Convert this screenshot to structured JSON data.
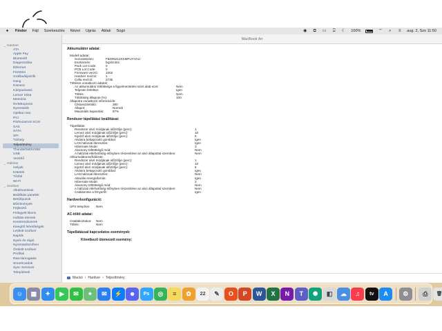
{
  "menubar": {
    "apple": "",
    "items": [
      "Finder",
      "Fájl",
      "Szerkesztés",
      "Nézet",
      "Ugrás",
      "Ablak",
      "Súgó"
    ],
    "battery": "100%",
    "clock": "aug. 2, Szo 11:50"
  },
  "window": {
    "title": "MacBook Air"
  },
  "sidebar": {
    "groups": [
      {
        "label": "Hardver",
        "items": [
          "ATA",
          "Apple Pay",
          "Bluetooth",
          "Diagnosztika",
          "Ethernet",
          "FireWire",
          "Grafika/kijelzők",
          "Hang",
          "Kamera",
          "Kártyaolvasó",
          "Lemez írása",
          "Memória",
          "NVMExpress",
          "Nyomtatók",
          "Optikai csat",
          "PCI",
          "Párhuzamos SCSI",
          "SAS",
          "SATA",
          "SPI",
          "Tárhely",
          "Teljesítmény",
          "Thunderbolt/USB4",
          "USB",
          "Vezérlő"
        ]
      },
      {
        "label": "Hálózat",
        "items": [
          "Helyek",
          "Kötetek",
          "Tűzfal",
          "Wi-Fi"
        ]
      },
      {
        "label": "Szoftver",
        "items": [
          "Alkalmazások",
          "Beállítási panelek",
          "Betűtípusok",
          "Bővítmények",
          "Fejlesztő",
          "Felügyelt kliens",
          "Indítási elemek",
          "Keretrendszerek",
          "Kisegítő lehetőségek",
          "Letiltott szoftver",
          "Naplók",
          "Nyelv és régió",
          "Nyomtatószoftver",
          "Örökölt szoftver",
          "Profilok",
          "Raw-támogatás",
          "SmartCardok",
          "Sync Services",
          "Telepítések"
        ]
      }
    ],
    "selected": "Teljesítmény"
  },
  "content": {
    "battery_heading": "Akkumulátor adatai:",
    "model_heading": "Modell adatai:",
    "model": [
      {
        "k": "Sorozatszám:",
        "v": "F5D05212XXMPUYVAU"
      },
      {
        "k": "Eszköznév:",
        "v": "bq20z451"
      },
      {
        "k": "Pack Lot Code:",
        "v": "0"
      },
      {
        "k": "PCB Lot Code:",
        "v": "0"
      },
      {
        "k": "Firmware verzió:",
        "v": "1002"
      },
      {
        "k": "Hardver revízió:",
        "v": "1"
      },
      {
        "k": "Cella revízió:",
        "v": "2735"
      }
    ],
    "charge_heading": "Töltésre vonatkozó adatok:",
    "charge": [
      {
        "k": "Az akkumulátor töltöttsége a figyelmeztetési szint alatt ecet:",
        "v": "Nem"
      },
      {
        "k": "Teljesen feltöltve:",
        "v": "Igen"
      },
      {
        "k": "Töltés:",
        "v": "Nem"
      },
      {
        "k": "Töltöttség állapota (%):",
        "v": "100"
      }
    ],
    "health_heading": "Állapotra vonatkozó információk:",
    "health": [
      {
        "k": "Ciklusszámláló:",
        "v": "380"
      },
      {
        "k": "Állapot:",
        "v": "Normál"
      },
      {
        "k": "Maximális kapacitás:",
        "v": "87%"
      }
    ],
    "power_heading": "Rendszer tápellátási beállításai:",
    "ac_heading": "Tápellátás:",
    "ac": [
      {
        "k": "Rendszer alvó módjának időzítője (perc):",
        "v": "1"
      },
      {
        "k": "Lemez alvó módjának időzítője (perc):",
        "v": "10"
      },
      {
        "k": "Kijelző alvó módjának időzítője (perc):",
        "v": "5"
      },
      {
        "k": "Alvásra bekapcsoló gombbal:",
        "v": "Igen"
      },
      {
        "k": "LAN hálózati ébresztés:",
        "v": "Igen"
      },
      {
        "k": "Hibernate Mode:",
        "v": "3"
      },
      {
        "k": "Alacsony töltöttségű mód:",
        "v": "Nem"
      },
      {
        "k": "A hálózati elérhetőség előnyben részesítése az alvó állapottal szemben:",
        "v": "Nem"
      }
    ],
    "bat_heading": "Akkumulátoros/hálózati:",
    "bat": [
      {
        "k": "Rendszer alvó módjának időzítője (perc):",
        "v": "1"
      },
      {
        "k": "Lemez alvó módjának időzítője (perc):",
        "v": "10"
      },
      {
        "k": "Kijelző alvó módjának időzítője (perc):",
        "v": "5"
      },
      {
        "k": "Alvásra bekapcsoló gombbal:",
        "v": "Igen"
      },
      {
        "k": "LAN hálózati ébresztés:",
        "v": "Nem"
      },
      {
        "k": "Aktuális energiaforrás:",
        "v": "Igen"
      },
      {
        "k": "Hibernate Mode:",
        "v": "3"
      },
      {
        "k": "Alacsony töltöttségű mód:",
        "v": "Nem"
      },
      {
        "k": "A hálózati elérhetőség előnyben részesítése az alvó állapottal szemben:",
        "v": "Nem"
      },
      {
        "k": "Csökkentse a fényerőt:",
        "v": "Igen"
      }
    ],
    "hw_heading": "Hardverkonfiguráció:",
    "hw": [
      {
        "k": "UPS telepítve:",
        "v": "Nem"
      }
    ],
    "acc_heading": "AC-töltő adatai:",
    "acc": [
      {
        "k": "Csatlakoztatva:",
        "v": "Nem"
      },
      {
        "k": "Töltés:",
        "v": "Nem"
      }
    ],
    "events_heading": "Tápellátással kapcsolatos események:",
    "next_heading": "Következő ütemezett esemény:"
  },
  "pathbar": {
    "items": [
      "Mackó",
      "Hardver",
      "Teljesítmény"
    ],
    "separator": "›"
  },
  "dock": {
    "apps": [
      {
        "name": "finder-icon",
        "color": "#3b8ff0",
        "glyph": "☺"
      },
      {
        "name": "launchpad-icon",
        "color": "#8a8aa8",
        "glyph": "▦"
      },
      {
        "name": "safari-icon",
        "color": "#2f8cf0",
        "glyph": "✦"
      },
      {
        "name": "facetime-icon",
        "color": "#34c759",
        "glyph": "▶"
      },
      {
        "name": "messages-icon",
        "color": "#30c048",
        "glyph": "✉"
      },
      {
        "name": "maps-icon",
        "color": "#6bc17a",
        "glyph": "⌖"
      },
      {
        "name": "mail-icon",
        "color": "#2b7ff2",
        "glyph": "✉"
      },
      {
        "name": "messenger-icon",
        "color": "#0a7cff",
        "glyph": "⚡"
      },
      {
        "name": "discord-icon",
        "color": "#5865f2",
        "glyph": "☻"
      },
      {
        "name": "photoshop-icon",
        "color": "#31a8ff",
        "glyph": "Ps"
      },
      {
        "name": "find-my-icon",
        "color": "#35b45b",
        "glyph": "◎"
      },
      {
        "name": "notes-icon",
        "color": "#f5d85c",
        "glyph": "≡"
      },
      {
        "name": "photos-icon",
        "color": "#f0a030",
        "glyph": "✿"
      },
      {
        "name": "calendar-icon",
        "color": "#f2f2f2",
        "glyph": "22"
      },
      {
        "name": "freeform-icon",
        "color": "#ececec",
        "glyph": "✎"
      },
      {
        "name": "office-icon",
        "color": "#e8501f",
        "glyph": "O"
      },
      {
        "name": "powerpoint-icon",
        "color": "#d24726",
        "glyph": "P"
      },
      {
        "name": "word-icon",
        "color": "#2b579a",
        "glyph": "W"
      },
      {
        "name": "excel-icon",
        "color": "#217346",
        "glyph": "X"
      },
      {
        "name": "onenote-icon",
        "color": "#7719aa",
        "glyph": "N"
      },
      {
        "name": "teams-icon",
        "color": "#5b5fc7",
        "glyph": "T"
      },
      {
        "name": "chatgpt-icon",
        "color": "#10a37f",
        "glyph": "✺"
      },
      {
        "name": "preview-icon",
        "color": "#d9d9d9",
        "glyph": "◧"
      },
      {
        "name": "weather-icon",
        "color": "#4a90e2",
        "glyph": "☁"
      },
      {
        "name": "music-icon",
        "color": "#fa3c4c",
        "glyph": "♫"
      },
      {
        "name": "apple-tv-icon",
        "color": "#111111",
        "glyph": "tv"
      },
      {
        "name": "app-store-icon",
        "color": "#1c8cf0",
        "glyph": "A"
      },
      {
        "name": "settings-icon",
        "color": "#8e8e93",
        "glyph": "⚙"
      },
      {
        "name": "printer-icon",
        "color": "#d0d0d0",
        "glyph": "⎙"
      },
      {
        "name": "trash-icon",
        "color": "#e4e4e4",
        "glyph": "🗑"
      }
    ],
    "separator_after": [
      27,
      28
    ]
  }
}
